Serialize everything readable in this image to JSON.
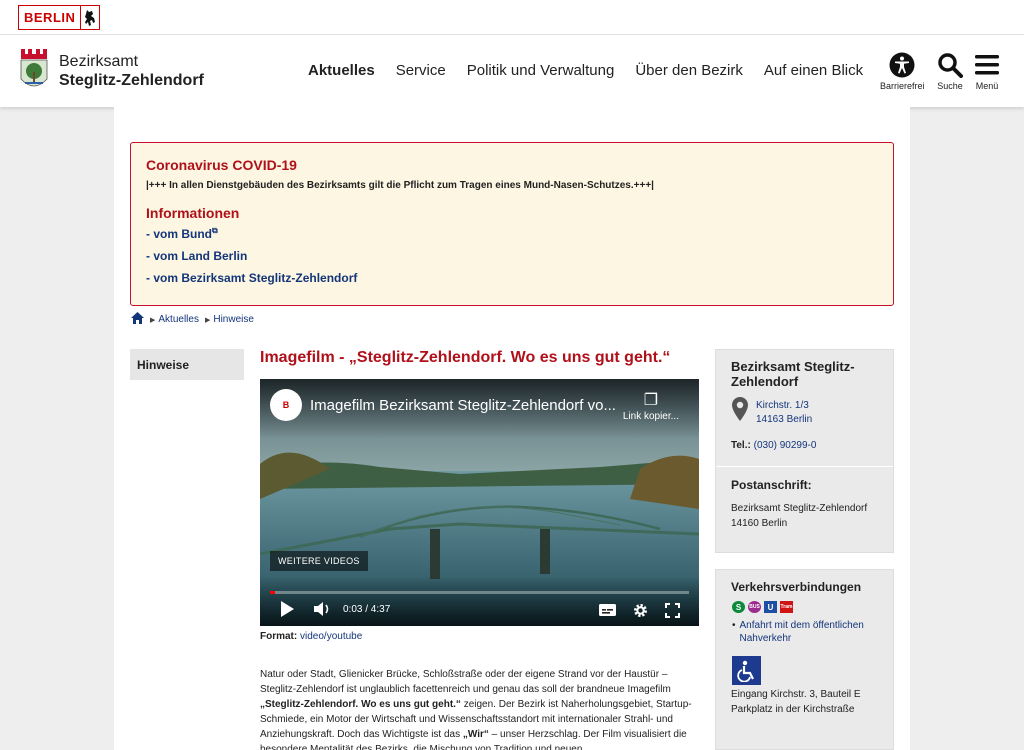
{
  "top_strip": {
    "berlin_label": "BERLIN"
  },
  "header": {
    "district_line1": "Bezirksamt",
    "district_line2": "Steglitz-Zehlendorf",
    "nav": [
      "Aktuelles",
      "Service",
      "Politik und Verwaltung",
      "Über den Bezirk",
      "Auf einen Blick"
    ],
    "active_nav": "Aktuelles",
    "tools": {
      "accessibility": "Barrierefrei",
      "search": "Suche",
      "menu": "Menü"
    }
  },
  "corona": {
    "title": "Coronavirus COVID-19",
    "notice": "|+++ In allen Dienstgebäuden des Bezirksamts gilt die Pflicht zum Tragen eines Mund-Nasen-Schutzes.+++|",
    "info_heading": "Informationen",
    "links": [
      "- vom Bund",
      "- vom Land Berlin",
      "- vom Bezirksamt Steglitz-Zehlendorf"
    ]
  },
  "breadcrumb": [
    "Aktuelles",
    "Hinweise"
  ],
  "left_nav": {
    "item": "Hinweise"
  },
  "article": {
    "title": "Imagefilm - „Steglitz-Zehlendorf. Wo es uns gut geht.“",
    "video": {
      "title": "Imagefilm Bezirksamt Steglitz-Zehlendorf vo...",
      "copy_label": "Link kopier...",
      "logo_text": "B",
      "more_videos": "WEITERE VIDEOS",
      "time": "0:03 / 4:37",
      "progress": 0.011
    },
    "format_label": "Format:",
    "format_value": "video/youtube",
    "body_p1": "Natur oder Stadt, Glienicker Brücke, Schloßstraße oder der eigene Strand vor der Haustür – Steglitz-Zehlendorf ist unglaublich facettenreich und genau das soll der brandneue Imagefilm",
    "body_bold1": "„Steglitz-Zehlendorf. Wo es uns gut geht.“",
    "body_p2": " zeigen. Der Bezirk ist Naherholungsgebiet, Startup-Schmiede, ein Motor der Wirtschaft und Wissenschaftsstandort mit internationaler Strahl- und Anziehungskraft. Doch das Wichtigste ist das ",
    "body_bold2": "„Wir“",
    "body_p3": " – unser Herzschlag. Der Film visualisiert die besondere Mentalität des Bezirks, die Mischung von Tradition und neuen"
  },
  "contact": {
    "name": "Bezirksamt Steglitz-Zehlendorf",
    "street": "Kirchstr. 1/3",
    "city": "14163 Berlin",
    "tel_label": "Tel.:",
    "tel_value": "(030) 90299-0",
    "postal_heading": "Postanschrift:",
    "postal_line1": "Bezirksamt Steglitz-Zehlendorf",
    "postal_line2": "14160 Berlin"
  },
  "transit": {
    "heading": "Verkehrsverbindungen",
    "icons": [
      "S",
      "BUS",
      "U",
      "Tram"
    ],
    "link": "Anfahrt mit dem öffentlichen Nahverkehr",
    "access_line1": "Eingang Kirchstr. 3, Bauteil E",
    "access_line2": "Parkplatz in der Kirchstraße"
  }
}
